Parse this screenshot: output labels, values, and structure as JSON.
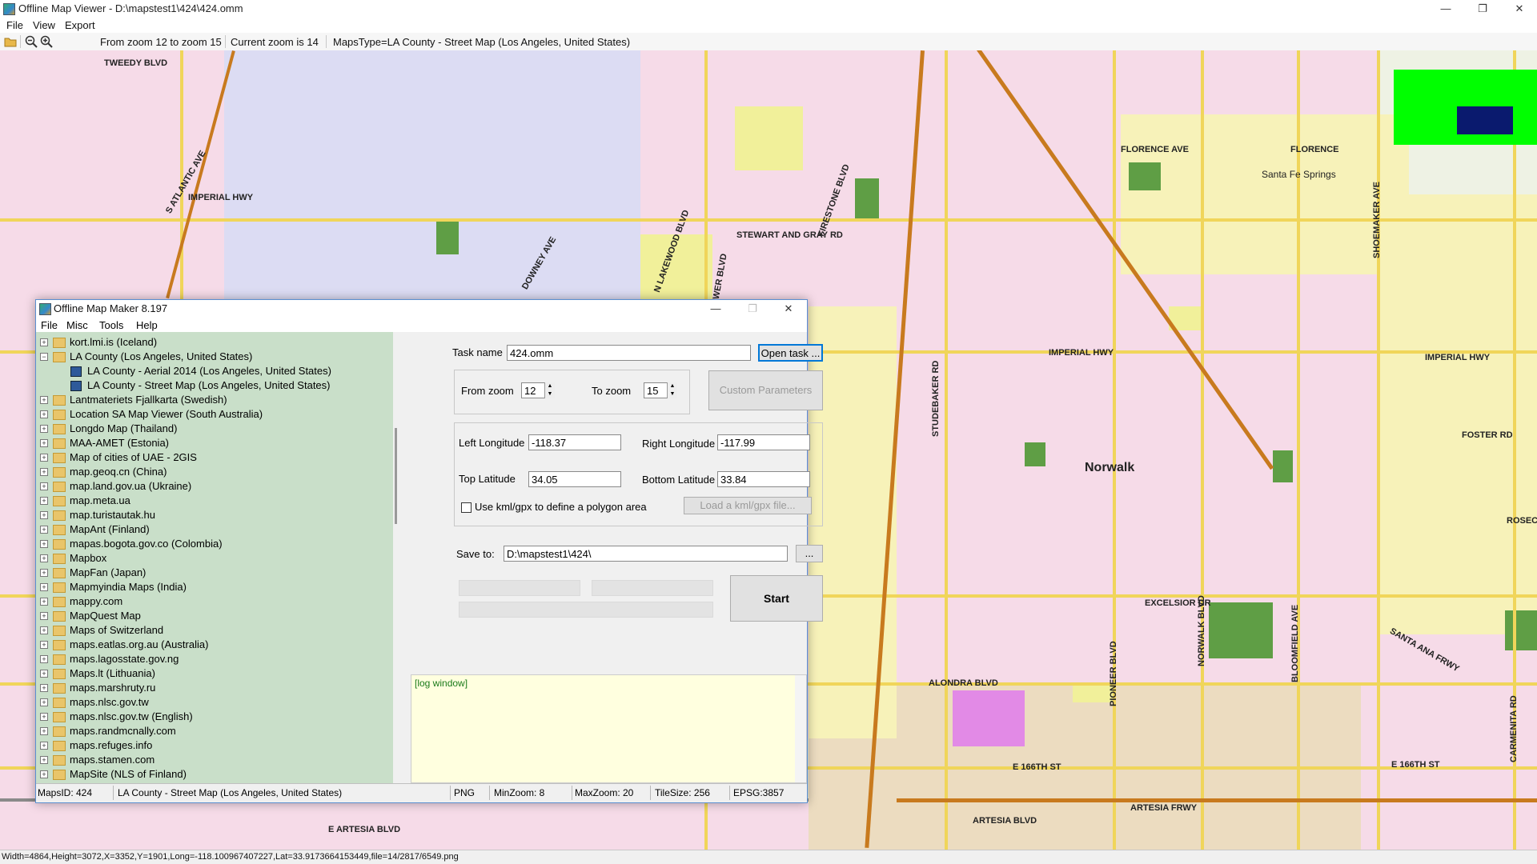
{
  "window": {
    "title": "Offline Map Viewer - D:\\mapstest1\\424\\424.omm",
    "minimize": "—",
    "maximize": "❐",
    "close": "✕"
  },
  "menu": [
    "File",
    "View",
    "Export"
  ],
  "toolbar": {
    "open_icon": "folder-open-icon",
    "zoom_out_icon": "zoom-out-icon",
    "zoom_in_icon": "zoom-in-icon",
    "zoom_range": "From zoom 12 to zoom 15",
    "current_zoom": "Current zoom is 14",
    "maps_type": "MapsType=LA County - Street Map (Los Angeles, United States)"
  },
  "map_labels": {
    "norwalk": "Norwalk",
    "santa_fe_springs": "Santa Fe Springs",
    "florence_ave": "FLORENCE AVE",
    "florence": "FLORENCE",
    "imperial_hwy_left": "IMPERIAL HWY",
    "imperial_hwy_mid": "IMPERIAL HWY",
    "imperial_hwy_right": "IMPERIAL HWY",
    "alondra_blvd": "ALONDRA BLVD",
    "artesia_fwy": "ARTESIA FRWY",
    "artesia_blvd": "E ARTESIA BLVD",
    "artesia_blvd2": "ARTESIA BLVD",
    "firestone_blvd": "FIRESTONE BLVD",
    "rosecrans": "ROSECRANS",
    "studebaker_rd": "STUDEBAKER RD",
    "pioneer_blvd": "PIONEER BLVD",
    "norwalk_blvd": "NORWALK BLVD",
    "bloomfield_ave": "BLOOMFIELD AVE",
    "shoemaker_ave": "SHOEMAKER AVE",
    "carmenita_rd": "CARMENITA RD",
    "santa_ana_fwy": "SANTA ANA FRWY",
    "lakewood_blvd": "N LAKEWOOD BLVD",
    "bellflower_blvd": "BELLFLOWER BLVD",
    "downey_ave": "DOWNEY AVE",
    "tweedy_blvd": "TWEEDY BLVD",
    "atlantic_ave": "S ATLANTIC AVE",
    "stewart_gray": "STEWART AND GRAY RD",
    "excelsior_dr": "EXCELSIOR DR",
    "foster_rd": "FOSTER RD",
    "e_166th": "E 166TH ST",
    "e_166th_right": "E 166TH ST"
  },
  "statusbar": "Width=4864,Height=3072,X=3352,Y=1901,Long=-118.100967407227,Lat=33.9173664153449,file=14/2817/6549.png",
  "dialog": {
    "title": "Offline Map Maker 8.197",
    "menu": [
      "File",
      "Misc",
      "Tools",
      "Help"
    ],
    "tree": [
      {
        "label": "kort.lmi.is (Iceland)",
        "level": 0,
        "expanded": false
      },
      {
        "label": "LA County (Los Angeles, United States)",
        "level": 0,
        "expanded": true
      },
      {
        "label": "LA County - Aerial 2014 (Los Angeles, United States)",
        "level": 1,
        "expanded": false
      },
      {
        "label": "LA County - Street Map (Los Angeles, United States)",
        "level": 1,
        "expanded": false
      },
      {
        "label": "Lantmateriets Fjallkarta (Swedish)",
        "level": 0,
        "expanded": false
      },
      {
        "label": "Location SA Map Viewer (South Australia)",
        "level": 0,
        "expanded": false
      },
      {
        "label": "Longdo Map (Thailand)",
        "level": 0,
        "expanded": false
      },
      {
        "label": "MAA-AMET (Estonia)",
        "level": 0,
        "expanded": false
      },
      {
        "label": "Map of cities of UAE - 2GIS",
        "level": 0,
        "expanded": false
      },
      {
        "label": "map.geoq.cn (China)",
        "level": 0,
        "expanded": false
      },
      {
        "label": "map.land.gov.ua (Ukraine)",
        "level": 0,
        "expanded": false
      },
      {
        "label": "map.meta.ua",
        "level": 0,
        "expanded": false
      },
      {
        "label": "map.turistautak.hu",
        "level": 0,
        "expanded": false
      },
      {
        "label": "MapAnt (Finland)",
        "level": 0,
        "expanded": false
      },
      {
        "label": "mapas.bogota.gov.co (Colombia)",
        "level": 0,
        "expanded": false
      },
      {
        "label": "Mapbox",
        "level": 0,
        "expanded": false
      },
      {
        "label": "MapFan (Japan)",
        "level": 0,
        "expanded": false
      },
      {
        "label": "Mapmyindia Maps (India)",
        "level": 0,
        "expanded": false
      },
      {
        "label": "mappy.com",
        "level": 0,
        "expanded": false
      },
      {
        "label": "MapQuest Map",
        "level": 0,
        "expanded": false
      },
      {
        "label": "Maps of Switzerland",
        "level": 0,
        "expanded": false
      },
      {
        "label": "maps.eatlas.org.au (Australia)",
        "level": 0,
        "expanded": false
      },
      {
        "label": "maps.lagosstate.gov.ng",
        "level": 0,
        "expanded": false
      },
      {
        "label": "Maps.lt (Lithuania)",
        "level": 0,
        "expanded": false
      },
      {
        "label": "maps.marshruty.ru",
        "level": 0,
        "expanded": false
      },
      {
        "label": "maps.nlsc.gov.tw",
        "level": 0,
        "expanded": false
      },
      {
        "label": "maps.nlsc.gov.tw (English)",
        "level": 0,
        "expanded": false
      },
      {
        "label": "maps.randmcnally.com",
        "level": 0,
        "expanded": false
      },
      {
        "label": "maps.refuges.info",
        "level": 0,
        "expanded": false
      },
      {
        "label": "maps.stamen.com",
        "level": 0,
        "expanded": false
      },
      {
        "label": "MapSite (NLS of Finland)",
        "level": 0,
        "expanded": false
      }
    ],
    "task_name_label": "Task name",
    "task_name": "424.omm",
    "open_task": "Open task ...",
    "from_zoom_label": "From zoom",
    "from_zoom": "12",
    "to_zoom_label": "To zoom",
    "to_zoom": "15",
    "custom_params": "Custom Parameters",
    "left_lon_label": "Left Longitude",
    "left_lon": "-118.37",
    "right_lon_label": "Right Longitude",
    "right_lon": "-117.99",
    "top_lat_label": "Top Latitude",
    "top_lat": "34.05",
    "bottom_lat_label": "Bottom Latitude",
    "bottom_lat": "33.84",
    "kml_checkbox": "Use kml/gpx to define a polygon area",
    "kml_checked": false,
    "load_kml": "Load a kml/gpx file...",
    "save_to_label": "Save to:",
    "save_to": "D:\\mapstest1\\424\\",
    "browse": "...",
    "start": "Start",
    "log": "[log window]",
    "status": {
      "maps_id": "MapsID: 424",
      "maps_name": "LA County - Street Map (Los Angeles, United States)",
      "format": "PNG",
      "min_zoom": "MinZoom: 8",
      "max_zoom": "MaxZoom: 20",
      "tile_size": "TileSize: 256",
      "epsg": "EPSG:3857"
    }
  },
  "colors": {
    "residential_pink": "#f6dbe8",
    "residential_lavender": "#dcdcf3",
    "commercial_yellow": "#f1f09a",
    "park_green": "#5f9e45",
    "industrial_tan": "#ecdcc0",
    "highway_orange": "#c87a1e",
    "arterial_yellow": "#f0d55a",
    "overview_green": "#00ff00",
    "overview_navy": "#0a1a6e",
    "tree_bg": "#c9dfc9",
    "log_bg": "#ffffdf"
  }
}
